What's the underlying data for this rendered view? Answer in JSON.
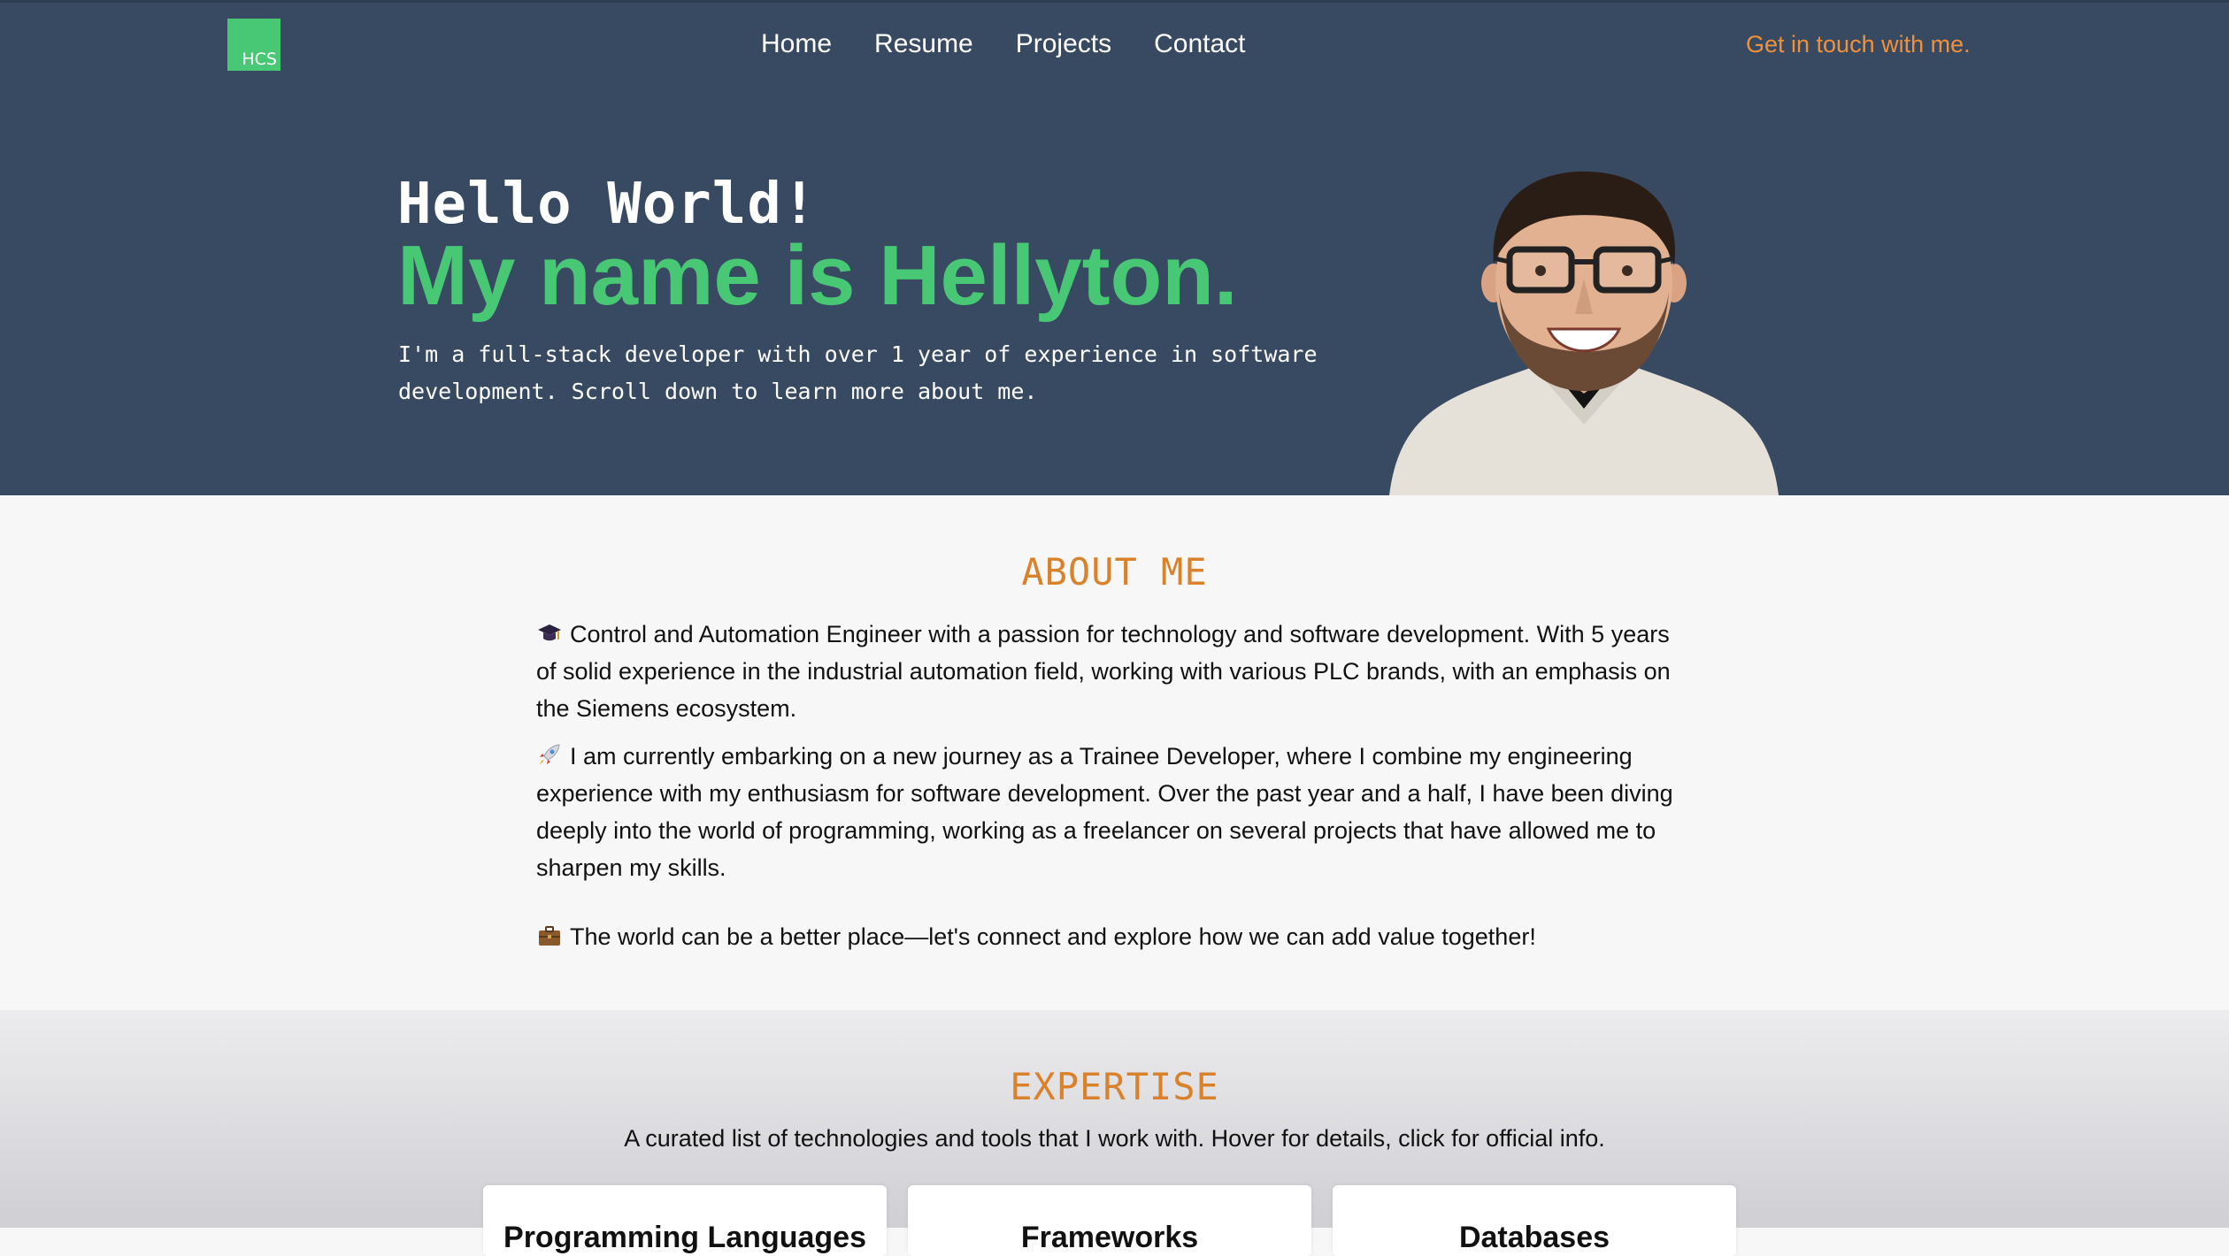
{
  "header": {
    "logo_text": "HCS",
    "nav": [
      {
        "label": "Home"
      },
      {
        "label": "Resume"
      },
      {
        "label": "Projects"
      },
      {
        "label": "Contact"
      }
    ],
    "cta": "Get in touch with me."
  },
  "hero": {
    "greeting": "Hello World!",
    "name_line": "My name is Hellyton.",
    "intro": "I'm a full-stack developer with over 1 year of experience in software development. Scroll down to learn more about me."
  },
  "about": {
    "title": "ABOUT ME",
    "paragraphs": [
      {
        "icon": "graduation-cap-icon",
        "text": "Control and Automation Engineer with a passion for technology and software development. With 5 years of solid experience in the industrial automation field, working with various PLC brands, with an emphasis on the Siemens ecosystem."
      },
      {
        "icon": "rocket-icon",
        "text": "I am currently embarking on a new journey as a Trainee Developer, where I combine my engineering experience with my enthusiasm for software development. Over the past year and a half, I have been diving deeply into the world of programming, working as a freelancer on several projects that have allowed me to sharpen my skills."
      },
      {
        "icon": "briefcase-icon",
        "text": "The world can be a better place—let's connect and explore how we can add value together!"
      }
    ]
  },
  "expertise": {
    "title": "EXPERTISE",
    "subtitle": "A curated list of technologies and tools that I work with. Hover for details, click for official info.",
    "cards": [
      {
        "label": "Programming Languages"
      },
      {
        "label": "Frameworks"
      },
      {
        "label": "Databases"
      }
    ]
  },
  "colors": {
    "header_bg": "#374a62",
    "accent_green": "#48c774",
    "accent_orange": "#d9822b",
    "cta_orange": "#f0913a"
  }
}
